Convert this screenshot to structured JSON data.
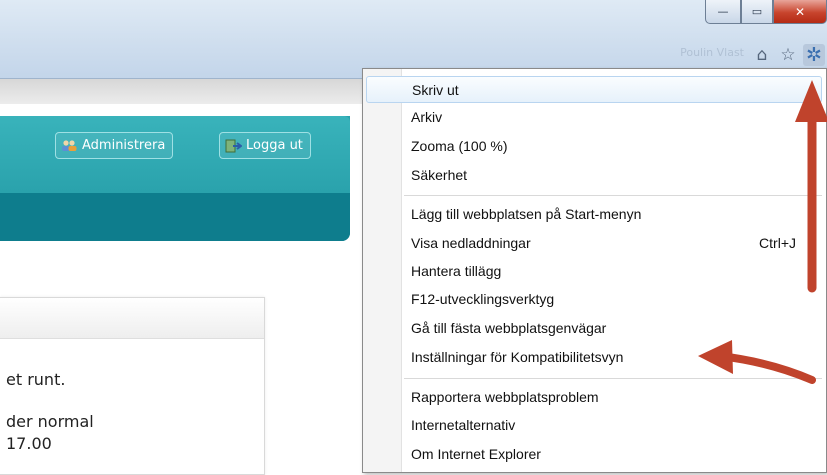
{
  "window": {
    "minimize_glyph": "—",
    "maximize_glyph": "▭",
    "close_glyph": "✕"
  },
  "toolbar": {
    "icons": [
      "home-icon",
      "favorites-star-icon",
      "tools-gear-icon"
    ],
    "home_glyph": "⌂",
    "star_glyph": "☆",
    "gear_glyph": "✲",
    "blurred_text": "Poulin Vlast"
  },
  "header": {
    "admin_label": "Administrera",
    "logout_label": "Logga ut",
    "accent_color": "#29a3ac",
    "nav_color": "#0e7d8d"
  },
  "content": {
    "line1": "et runt.",
    "line2": "der normal",
    "line3": "17.00"
  },
  "menu": {
    "items": [
      {
        "label": "Skriv ut"
      },
      {
        "label": "Arkiv"
      },
      {
        "label": "Zooma (100 %)"
      },
      {
        "label": "Säkerhet"
      },
      {
        "label": "Lägg till webbplatsen på Start-menyn"
      },
      {
        "label": "Visa nedladdningar",
        "shortcut": "Ctrl+J"
      },
      {
        "label": "Hantera tillägg"
      },
      {
        "label": "F12-utvecklingsverktyg"
      },
      {
        "label": "Gå till fästa webbplatsgenvägar"
      },
      {
        "label": "Inställningar för Kompatibilitetsvyn"
      },
      {
        "label": "Rapportera webbplatsproblem"
      },
      {
        "label": "Internetalternativ"
      },
      {
        "label": "Om Internet Explorer"
      }
    ]
  },
  "annotations": {
    "arrow_color": "#c0432c"
  }
}
